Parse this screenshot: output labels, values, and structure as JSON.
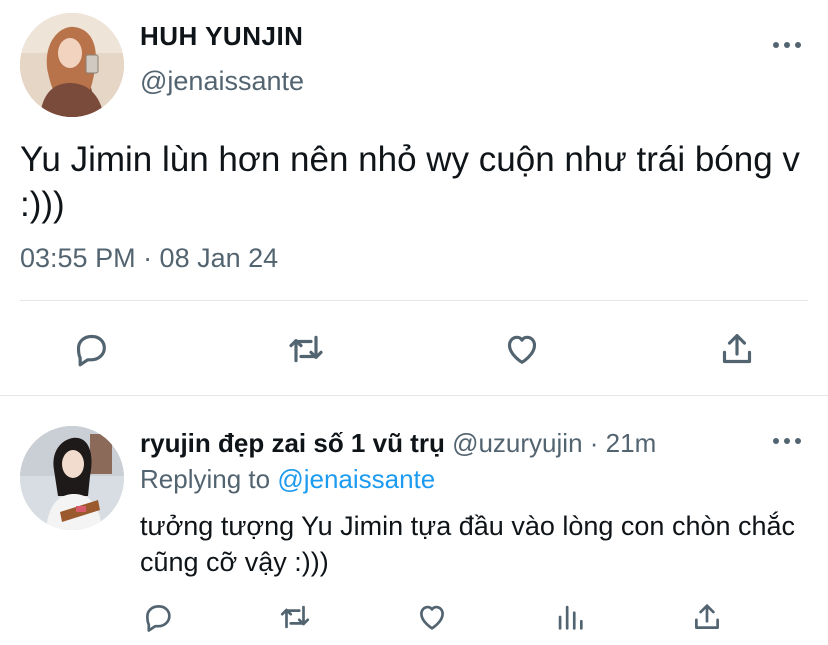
{
  "main_tweet": {
    "author_name": "HUH YUNJIN",
    "author_handle": "@jenaissante",
    "text": "Yu Jimin lùn hơn nên nhỏ wy cuộn như trái bóng v :)))",
    "timestamp": "03:55 PM · 08 Jan 24",
    "actions": [
      "reply-icon",
      "retweet-icon",
      "like-icon",
      "share-icon"
    ]
  },
  "reply_tweet": {
    "author_name": "ryujin đẹp zai số 1 vũ trụ",
    "author_handle": "@uzuryujin",
    "separator": "·",
    "time": "21m",
    "replying_prefix": "Replying to",
    "replying_to": "@jenaissante",
    "text": "tưởng tượng Yu Jimin tựa đầu vào lòng con chòn chắc cũng cỡ vậy :)))",
    "actions": [
      "reply-icon",
      "retweet-icon",
      "like-icon",
      "analytics-icon",
      "share-icon"
    ]
  },
  "colors": {
    "text_primary": "#0f1419",
    "text_secondary": "#536471",
    "mention": "#1d9bf0",
    "divider": "#e3e7ea"
  }
}
